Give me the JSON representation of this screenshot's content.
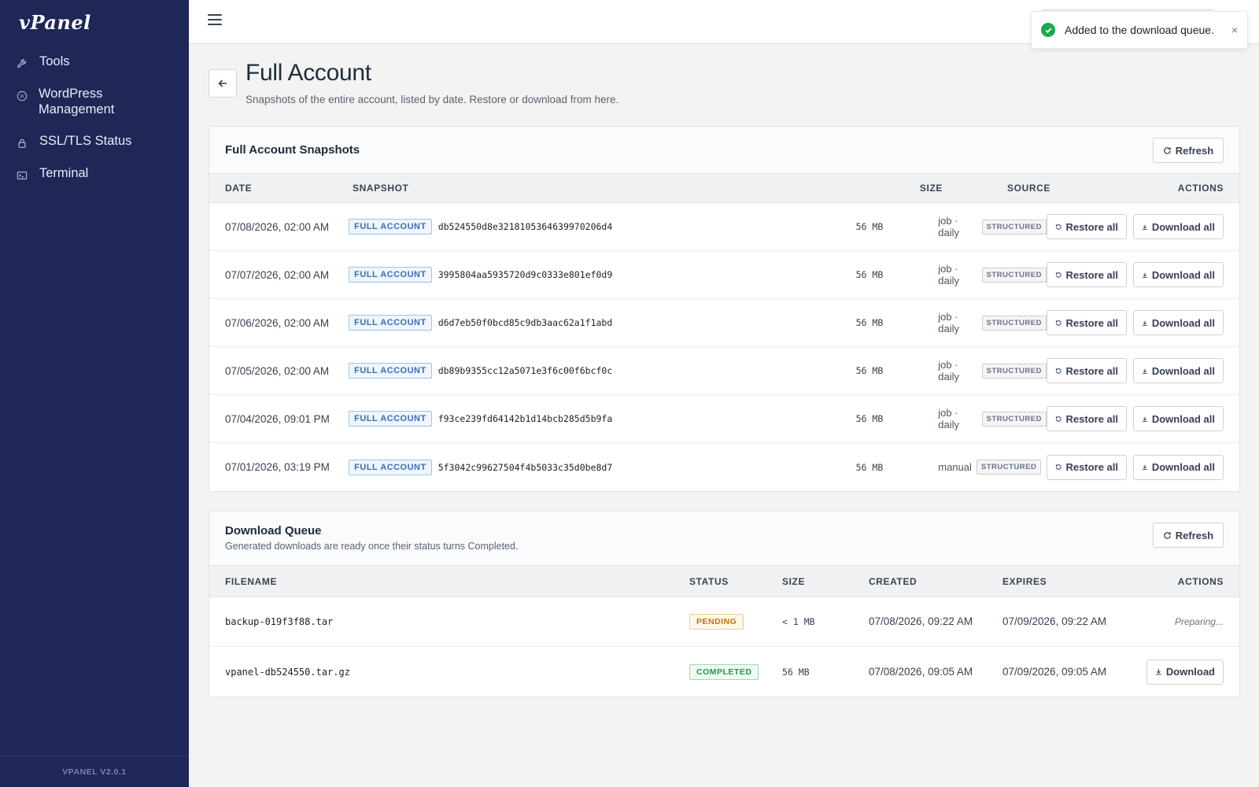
{
  "app": {
    "logo": "vPanel",
    "version": "VPANEL V2.0.1"
  },
  "sidebar": {
    "items": [
      {
        "label": "Tools",
        "icon": "wrench-icon"
      },
      {
        "label": "WordPress Management",
        "icon": "wordpress-icon"
      },
      {
        "label": "SSL/TLS Status",
        "icon": "lock-icon"
      },
      {
        "label": "Terminal",
        "icon": "terminal-icon"
      }
    ]
  },
  "toast": {
    "message": "Added to the download queue.",
    "close": "×"
  },
  "page": {
    "title": "Full Account",
    "subtitle": "Snapshots of the entire account, listed by date. Restore or download from here."
  },
  "snapshots": {
    "title": "Full Account Snapshots",
    "refresh_label": "Refresh",
    "columns": {
      "date": "DATE",
      "snapshot": "SNAPSHOT",
      "size": "SIZE",
      "source": "SOURCE",
      "actions": "ACTIONS"
    },
    "restore_label": "Restore all",
    "download_label": "Download all",
    "rows": [
      {
        "date": "07/08/2026, 02:00 AM",
        "type": "FULL ACCOUNT",
        "id": "db524550d8e3218105364639970206d4",
        "size": "56 MB",
        "source": "job · daily",
        "tag": "STRUCTURED"
      },
      {
        "date": "07/07/2026, 02:00 AM",
        "type": "FULL ACCOUNT",
        "id": "3995804aa5935720d9c0333e801ef0d9",
        "size": "56 MB",
        "source": "job · daily",
        "tag": "STRUCTURED"
      },
      {
        "date": "07/06/2026, 02:00 AM",
        "type": "FULL ACCOUNT",
        "id": "d6d7eb50f0bcd85c9db3aac62a1f1abd",
        "size": "56 MB",
        "source": "job · daily",
        "tag": "STRUCTURED"
      },
      {
        "date": "07/05/2026, 02:00 AM",
        "type": "FULL ACCOUNT",
        "id": "db89b9355cc12a5071e3f6c00f6bcf0c",
        "size": "56 MB",
        "source": "job · daily",
        "tag": "STRUCTURED"
      },
      {
        "date": "07/04/2026, 09:01 PM",
        "type": "FULL ACCOUNT",
        "id": "f93ce239fd64142b1d14bcb285d5b9fa",
        "size": "56 MB",
        "source": "job · daily",
        "tag": "STRUCTURED"
      },
      {
        "date": "07/01/2026, 03:19 PM",
        "type": "FULL ACCOUNT",
        "id": "5f3042c99627504f4b5033c35d0be8d7",
        "size": "56 MB",
        "source": "manual",
        "tag": "STRUCTURED"
      }
    ]
  },
  "queue": {
    "title": "Download Queue",
    "description": "Generated downloads are ready once their status turns Completed.",
    "refresh_label": "Refresh",
    "columns": {
      "filename": "FILENAME",
      "status": "STATUS",
      "size": "SIZE",
      "created": "CREATED",
      "expires": "EXPIRES",
      "actions": "ACTIONS"
    },
    "rows": [
      {
        "filename": "backup-019f3f88.tar",
        "status": "PENDING",
        "size": "< 1 MB",
        "created": "07/08/2026, 09:22 AM",
        "expires": "07/09/2026, 09:22 AM",
        "action": "Preparing..."
      },
      {
        "filename": "vpanel-db524550.tar.gz",
        "status": "COMPLETED",
        "size": "56 MB",
        "created": "07/08/2026, 09:05 AM",
        "expires": "07/09/2026, 09:05 AM",
        "action": "Download"
      }
    ]
  },
  "colors": {
    "sidebar": "#1e2756",
    "accent": "#3a6fae",
    "success": "#1ea950",
    "pending": "#c27807"
  }
}
